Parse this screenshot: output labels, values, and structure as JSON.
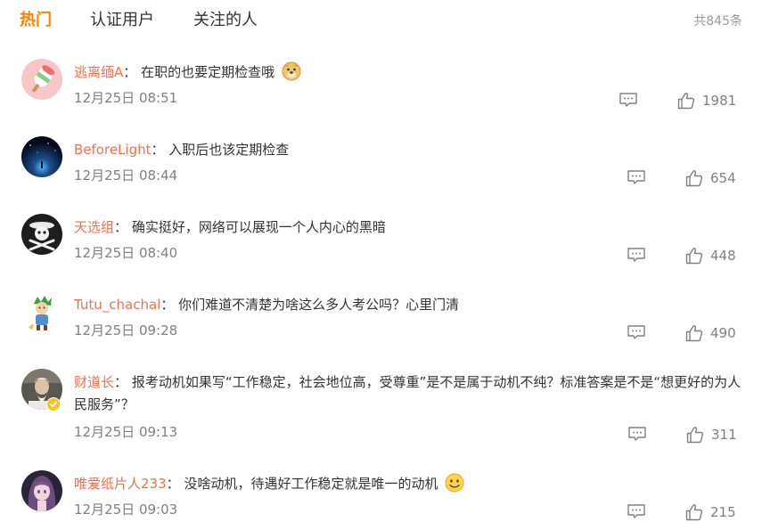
{
  "tabs": [
    {
      "label": "热门",
      "active": true
    },
    {
      "label": "认证用户",
      "active": false
    },
    {
      "label": "关注的人",
      "active": false
    }
  ],
  "total_count": "共845条",
  "colors": {
    "accent": "#ff8200",
    "username": "#eb7350",
    "meta": "#808080"
  },
  "comments": [
    {
      "user": "逃离缅A",
      "sep": "：",
      "text": "在职的也要定期检查哦",
      "emoji": "doge-emoji",
      "time": "12月25日 08:51",
      "likes": "1981",
      "avatar": "popsicle-avatar"
    },
    {
      "user": "BeforeLight",
      "sep": "：",
      "text": "入职后也该定期检查",
      "time": "12月25日 08:44",
      "likes": "654",
      "avatar": "night-sky-avatar"
    },
    {
      "user": "天选组",
      "sep": "：",
      "text": "确实挺好，网络可以展现一个人内心的黑暗",
      "time": "12月25日 08:40",
      "likes": "448",
      "avatar": "skull-flag-avatar"
    },
    {
      "user": "Tutu_chachal",
      "sep": "：",
      "text": "你们难道不清楚为啥这么多人考公吗？心里门清",
      "time": "12月25日 09:28",
      "likes": "490",
      "avatar": "cartoon-character-avatar"
    },
    {
      "user": "财道长",
      "sep": "：",
      "text": "报考动机如果写“工作稳定，社会地位高，受尊重”是不是属于动机不纯？标准答案是不是“想更好的为人民服务”？",
      "time": "12月25日 09:13",
      "likes": "311",
      "avatar": "elder-avatar",
      "verified": true
    },
    {
      "user": "唯爱纸片人233",
      "sep": "：",
      "text": "没啥动机，待遇好工作稳定就是唯一的动机",
      "emoji": "smile-emoji",
      "time": "12月25日 09:03",
      "likes": "215",
      "avatar": "anime-girl-avatar"
    }
  ]
}
